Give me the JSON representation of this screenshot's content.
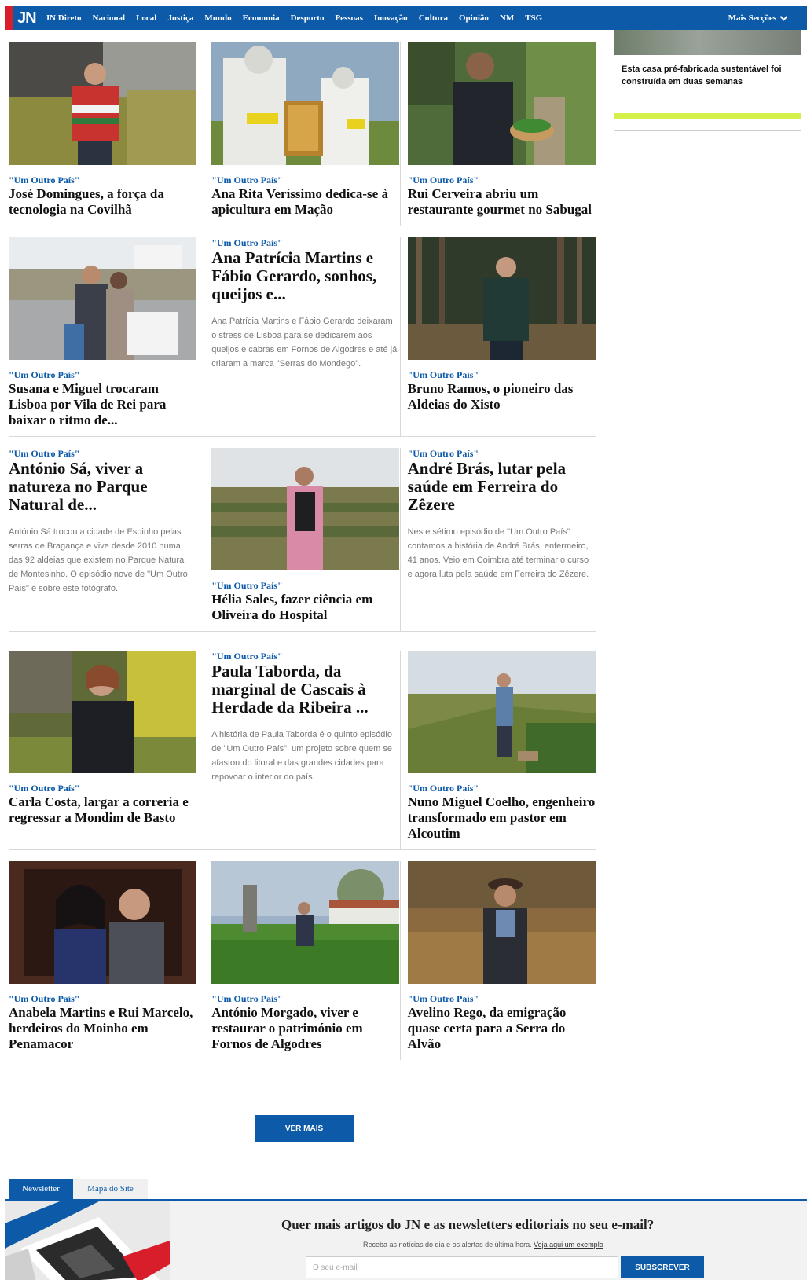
{
  "header": {
    "logo": "JN",
    "nav": [
      "JN Direto",
      "Nacional",
      "Local",
      "Justiça",
      "Mundo",
      "Economia",
      "Desporto",
      "Pessoas",
      "Inovação",
      "Cultura",
      "Opinião",
      "NM",
      "TSG"
    ],
    "more_label": "Mais Secções"
  },
  "rows": [
    [
      {
        "kicker": "\"Um Outro País\"",
        "title": "José Domingues, a força da tecnologia na Covilhã"
      },
      {
        "kicker": "\"Um Outro País\"",
        "title": "Ana Rita Veríssimo dedica-se à apicultura em Mação"
      },
      {
        "kicker": "\"Um Outro País\"",
        "title": "Rui Cerveira abriu um restaurante gourmet no Sabugal"
      }
    ],
    [
      {
        "kicker": "\"Um Outro País\"",
        "title": "Susana e Miguel trocaram Lisboa por Vila de Rei para baixar o ritmo de..."
      },
      {
        "kicker": "\"Um Outro País\"",
        "title": "Ana Patrícia Martins e Fábio Gerardo, sonhos, queijos e...",
        "lead": "Ana Patrícia Martins e Fábio Gerardo deixaram o stress de Lisboa para se dedicarem aos queijos e cabras em Fornos de Algodres e até já criaram a marca \"Serras do Mondego\"."
      },
      {
        "kicker": "\"Um Outro País\"",
        "title": "Bruno Ramos, o pioneiro das Aldeias do Xisto"
      }
    ],
    [
      {
        "kicker": "\"Um Outro País\"",
        "title": "António Sá, viver a natureza no Parque Natural de...",
        "lead": "António Sá trocou a cidade de Espinho pelas serras de Bragança e vive desde 2010 numa das 92 aldeias que existem no Parque Natural de Montesinho. O episódio nove de \"Um Outro País\" é sobre este fotógrafo."
      },
      {
        "kicker": "\"Um Outro País\"",
        "title": "Hélia Sales, fazer ciência em Oliveira do Hospital"
      },
      {
        "kicker": "\"Um Outro País\"",
        "title": "André Brás, lutar pela saúde em Ferreira do Zêzere",
        "lead": "Neste sétimo episódio de \"Um Outro País\" contamos a história de André Brás, enfermeiro, 41 anos. Veio em Coimbra até terminar o curso e agora luta pela saúde em Ferreira do Zêzere."
      }
    ],
    [
      {
        "kicker": "\"Um Outro País\"",
        "title": "Carla Costa, largar a correria e regressar a Mondim de Basto"
      },
      {
        "kicker": "\"Um Outro País\"",
        "title": "Paula Taborda, da marginal de Cascais à Herdade da Ribeira ...",
        "lead": "A história de Paula Taborda é o quinto episódio de \"Um Outro País\", um projeto sobre quem se afastou do litoral e das grandes cidades para repovoar o interior do país."
      },
      {
        "kicker": "\"Um Outro País\"",
        "title": "Nuno Miguel Coelho, engenheiro transformado em pastor em Alcoutim"
      }
    ],
    [
      {
        "kicker": "\"Um Outro País\"",
        "title": "Anabela Martins e Rui Marcelo, herdeiros do Moinho em Penamacor"
      },
      {
        "kicker": "\"Um Outro País\"",
        "title": "António Morgado, viver e restaurar o património em Fornos de Algodres"
      },
      {
        "kicker": "\"Um Outro País\"",
        "title": "Avelino Rego, da emigração quase certa para a Serra do Alvão"
      }
    ]
  ],
  "sidebar": {
    "title": "Esta casa pré-fabricada sustentável foi construída em duas semanas"
  },
  "see_more": "VER MAIS",
  "tabs": [
    "Newsletter",
    "Mapa do Site"
  ],
  "newsletter": {
    "title": "Quer mais artigos do JN e as newsletters editoriais no seu e-mail?",
    "sub": "Receba as notícias do dia e os alertas de última hora.",
    "sub_link": "Veja aqui um exemplo",
    "placeholder": "O seu e-mail",
    "button": "SUBSCREVER"
  }
}
